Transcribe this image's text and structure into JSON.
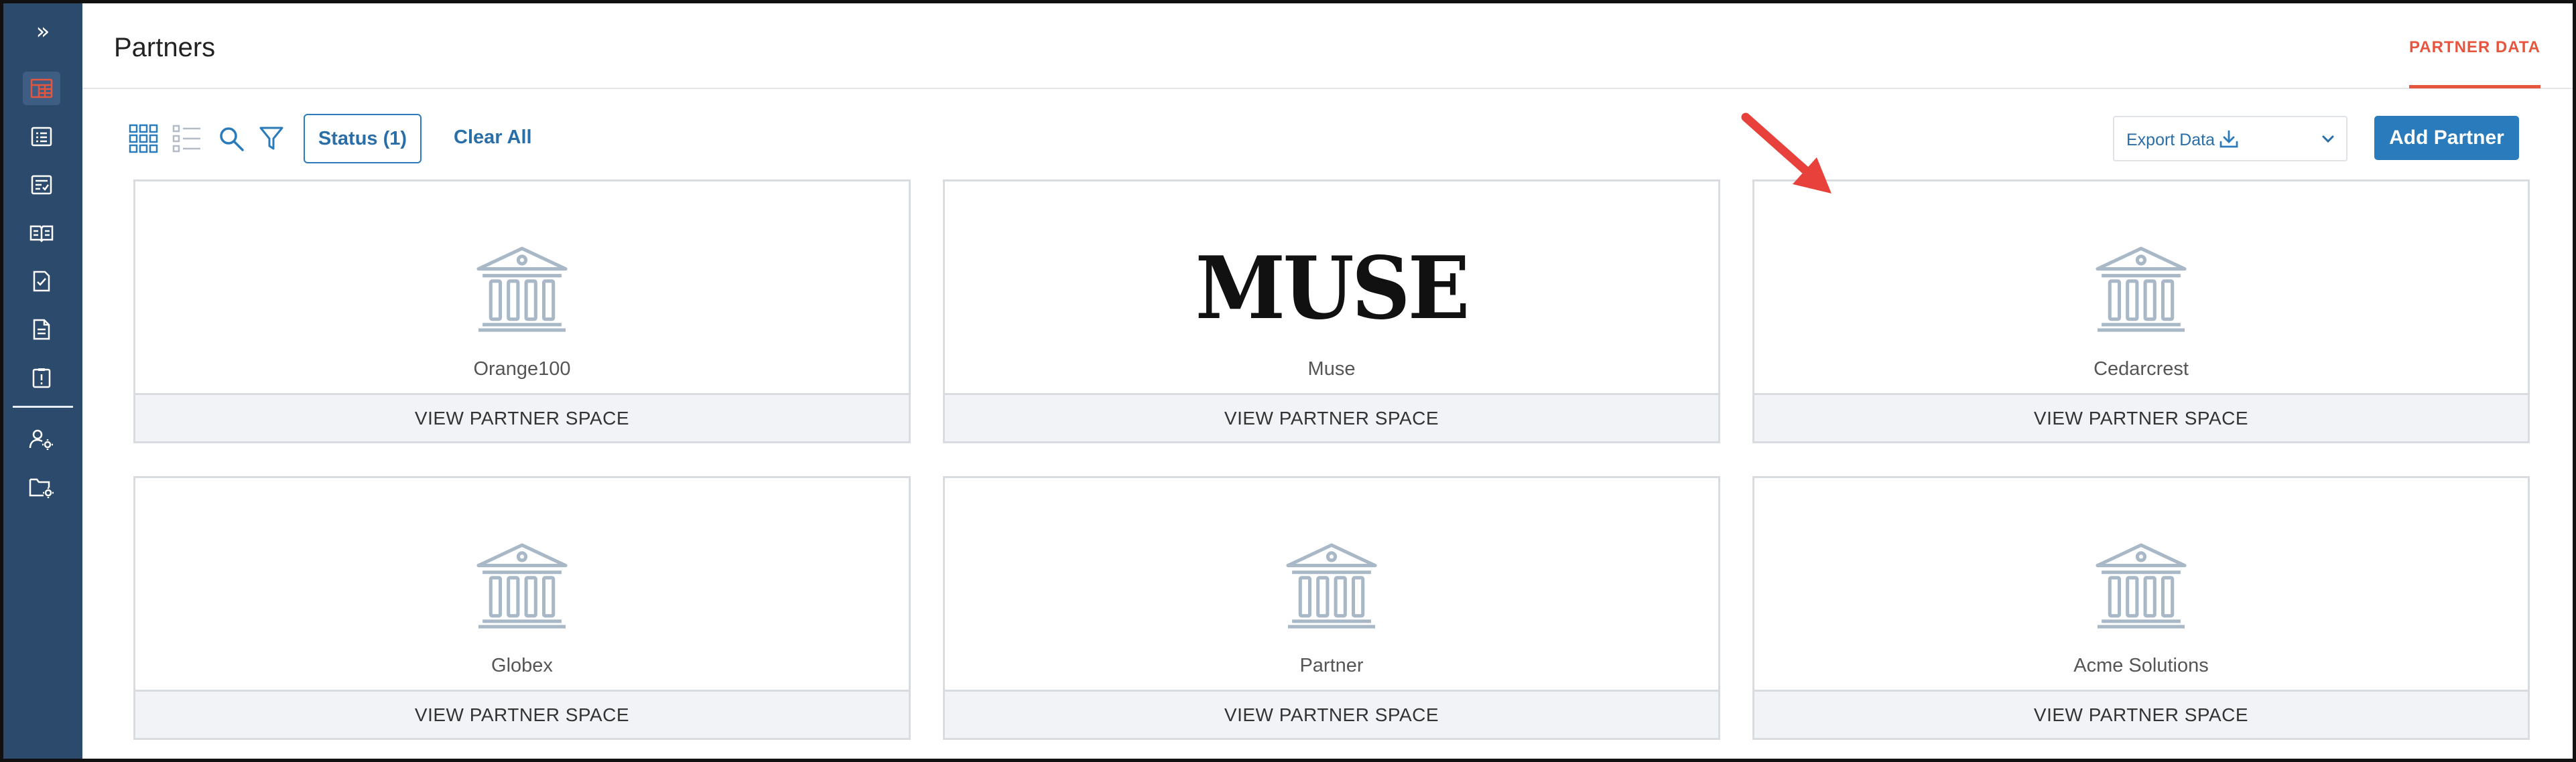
{
  "sidebar": {
    "toggle_icon": "double-chevron-right",
    "items": [
      {
        "name": "partners",
        "icon": "building-grid-icon",
        "active": true
      },
      {
        "name": "list",
        "icon": "list-box-icon"
      },
      {
        "name": "checklist",
        "icon": "checklist-icon"
      },
      {
        "name": "book",
        "icon": "open-book-icon"
      },
      {
        "name": "document-check",
        "icon": "document-check-icon"
      },
      {
        "name": "document",
        "icon": "document-icon"
      },
      {
        "name": "clipboard-alert",
        "icon": "clipboard-alert-icon"
      },
      {
        "name": "user-settings",
        "icon": "user-gear-icon"
      },
      {
        "name": "folder-settings",
        "icon": "folder-gear-icon"
      }
    ]
  },
  "header": {
    "title": "Partners",
    "tab_label": "PARTNER DATA"
  },
  "toolbar": {
    "status_filter_label": "Status (1)",
    "clear_all_label": "Clear All",
    "export_label": "Export Data",
    "add_partner_label": "Add Partner"
  },
  "partners": [
    {
      "name": "Orange100",
      "logo": "building-icon",
      "action": "VIEW PARTNER SPACE"
    },
    {
      "name": "Muse",
      "logo_text": "MUSE",
      "action": "VIEW PARTNER SPACE"
    },
    {
      "name": "Cedarcrest",
      "logo": "building-icon",
      "action": "VIEW PARTNER SPACE"
    },
    {
      "name": "Globex",
      "logo": "building-icon",
      "action": "VIEW PARTNER SPACE"
    },
    {
      "name": "Partner",
      "logo": "building-icon",
      "action": "VIEW PARTNER SPACE"
    },
    {
      "name": "Acme Solutions",
      "logo": "building-icon",
      "action": "VIEW PARTNER SPACE"
    }
  ],
  "colors": {
    "sidebar_bg": "#2c4a6b",
    "accent_orange": "#e8553e",
    "primary_blue": "#2a7bbb",
    "card_footer_bg": "#f1f3f6",
    "building_icon": "#a9b8c6",
    "annotation_arrow": "#e8413b"
  }
}
